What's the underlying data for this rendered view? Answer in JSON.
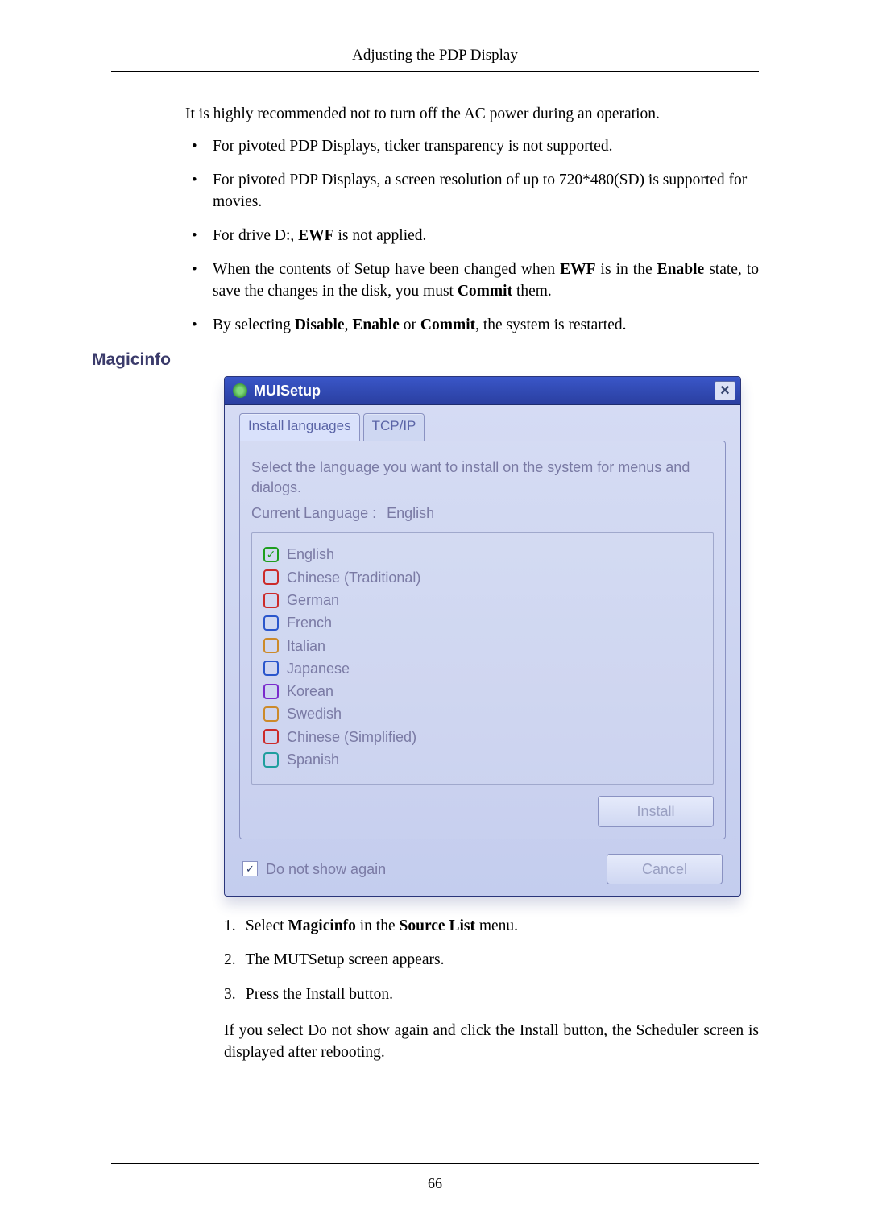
{
  "header": "Adjusting the PDP Display",
  "first_para": "It is highly recommended not to turn off the AC power during an operation.",
  "bullets": {
    "b1": "For pivoted PDP Displays, ticker transparency is not supported.",
    "b2": "For pivoted PDP Displays, a screen resolution of up to 720*480(SD) is supported for movies.",
    "b3_pre": "For drive D:, ",
    "b3_bold": "EWF",
    "b3_post": " is not applied.",
    "b4_a": "When the contents of Setup have been changed when ",
    "b4_ewf": "EWF",
    "b4_b": " is in the ",
    "b4_enable": "Enable",
    "b4_c": " state, to save the changes in the disk, you must ",
    "b4_commit": "Commit",
    "b4_d": " them.",
    "b5_a": "By selecting ",
    "b5_disable": "Disable",
    "b5_b": ", ",
    "b5_enable": "Enable",
    "b5_c": " or ",
    "b5_commit": "Commit",
    "b5_d": ", the system is restarted."
  },
  "section_heading": "Magicinfo",
  "dialog": {
    "title": "MUISetup",
    "close": "✕",
    "tabs": {
      "install": "Install languages",
      "tcpip": "TCP/IP"
    },
    "prompt": "Select the language you want to install on the system for menus and dialogs.",
    "current_label": "Current Language   :",
    "current_value": "English",
    "langs": [
      {
        "label": "English",
        "checked": true,
        "color": "green"
      },
      {
        "label": "Chinese (Traditional)",
        "checked": false,
        "color": "red"
      },
      {
        "label": "German",
        "checked": false,
        "color": "red"
      },
      {
        "label": "French",
        "checked": false,
        "color": "blue"
      },
      {
        "label": "Italian",
        "checked": false,
        "color": "orange"
      },
      {
        "label": "Japanese",
        "checked": false,
        "color": "blue"
      },
      {
        "label": "Korean",
        "checked": false,
        "color": "purple"
      },
      {
        "label": "Swedish",
        "checked": false,
        "color": "orange"
      },
      {
        "label": "Chinese (Simplified)",
        "checked": false,
        "color": "red"
      },
      {
        "label": "Spanish",
        "checked": false,
        "color": "teal"
      }
    ],
    "install_btn": "Install",
    "dont_show": "Do not show again",
    "dont_show_checked": "✓",
    "cancel_btn": "Cancel"
  },
  "steps": {
    "s1_a": "Select ",
    "s1_b1": "Magicinfo",
    "s1_b": " in the ",
    "s1_b2": "Source List",
    "s1_c": " menu.",
    "s2": "The MUTSetup screen appears.",
    "s3": "Press the Install button."
  },
  "trail": "If you select Do not show again and click the Install button, the Scheduler screen is displayed after rebooting.",
  "page_number": "66"
}
